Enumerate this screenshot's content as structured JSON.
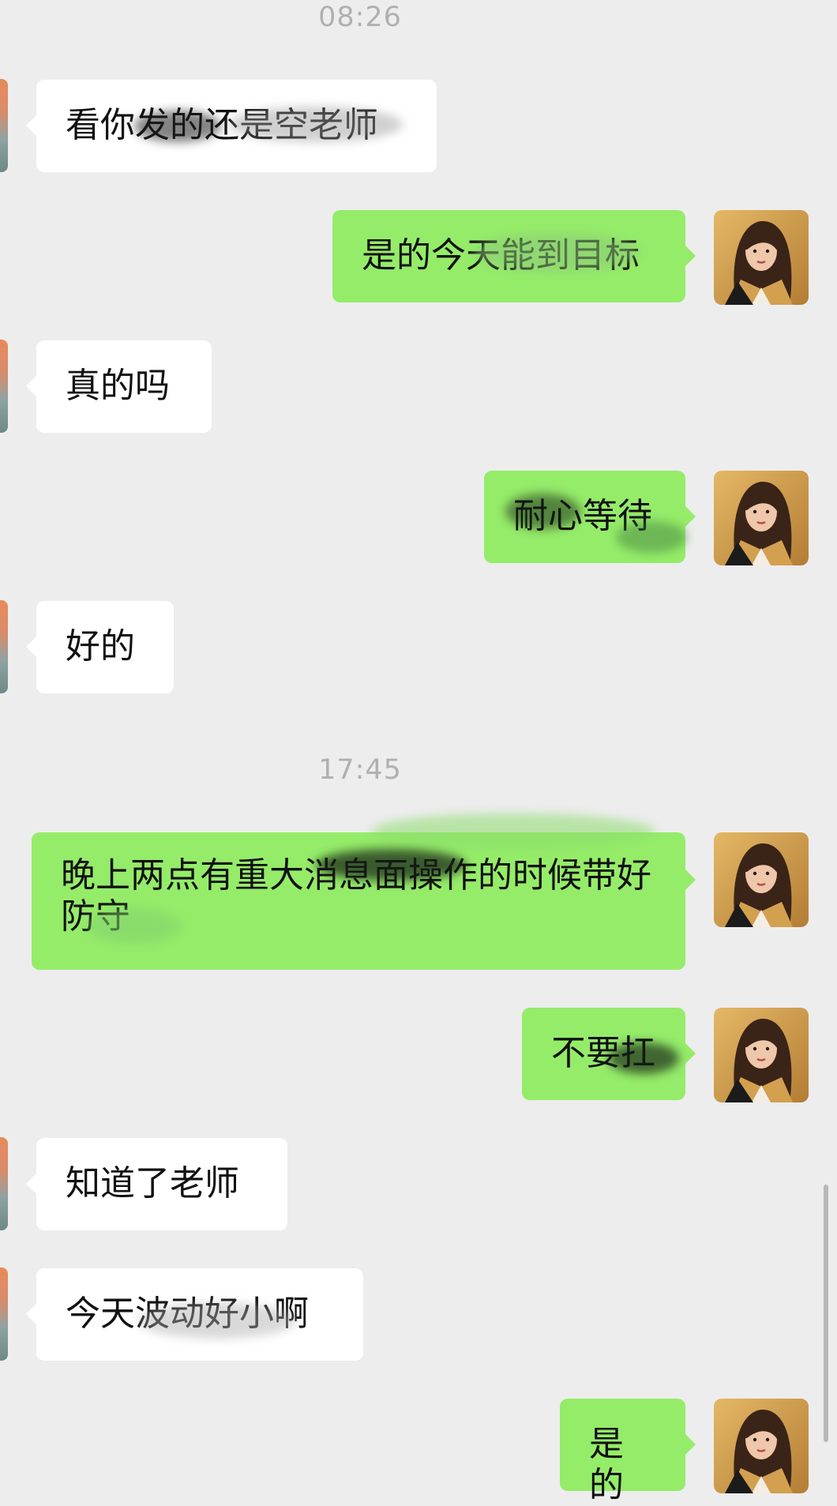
{
  "timestamps": [
    "08:26",
    "17:45"
  ],
  "messages": [
    {
      "side": "left",
      "text": "看你发的还是空老师"
    },
    {
      "side": "right",
      "text": "是的今天能到目标"
    },
    {
      "side": "left",
      "text": "真的吗"
    },
    {
      "side": "right",
      "text": "耐心等待"
    },
    {
      "side": "left",
      "text": "好的"
    },
    {
      "side": "right",
      "text": "晚上两点有重大消息面操作的时候带好防守"
    },
    {
      "side": "right",
      "text": "不要扛"
    },
    {
      "side": "left",
      "text": "知道了老师"
    },
    {
      "side": "left",
      "text": "今天波动好小啊"
    },
    {
      "side": "right",
      "text": "是的"
    }
  ],
  "colors": {
    "background": "#ededed",
    "incoming_bubble": "#ffffff",
    "outgoing_bubble": "#95ec69",
    "timestamp_text": "#b0b0b0"
  },
  "icons": {
    "self_avatar": "woman-in-blazer-avatar-icon",
    "peer_avatar": "sunset-landscape-avatar-icon"
  }
}
